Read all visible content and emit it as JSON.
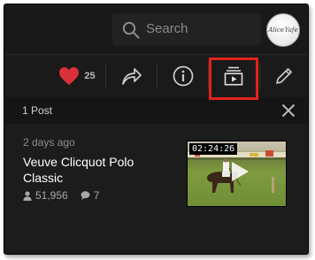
{
  "search": {
    "placeholder": "Search"
  },
  "profile": {
    "avatar_logo_text": "Alice Yafe"
  },
  "actions": {
    "like_count": "25",
    "like_color": "#d9303a",
    "highlight_color": "#e2231a"
  },
  "posts_panel": {
    "count_label": "1 Post"
  },
  "post": {
    "time_ago": "2 days ago",
    "title": "Veuve Clicquot Polo Classic",
    "views": "51,956",
    "comments": "7",
    "video_duration": "02:24:26"
  },
  "icons": [
    "search-icon",
    "heart-icon",
    "share-icon",
    "info-icon",
    "collection-play-icon",
    "pencil-icon",
    "close-icon",
    "person-icon",
    "comment-icon",
    "play-icon"
  ]
}
